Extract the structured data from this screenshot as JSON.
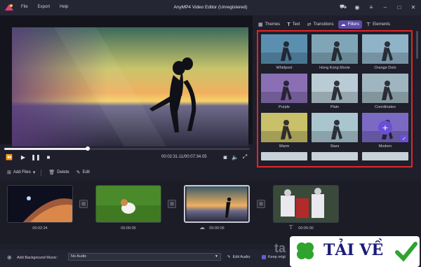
{
  "app": {
    "title": "AnyMP4 Video Editor (Unregistered)",
    "menu": [
      "File",
      "Export",
      "Help"
    ]
  },
  "player": {
    "time": "00:02:31.11/00:07:34.05",
    "progress_fraction": 0.34
  },
  "toolbar": {
    "add_files": "Add Files",
    "delete": "Delete",
    "edit": "Edit"
  },
  "tabs": [
    {
      "label": "Themes",
      "icon": "themes-icon"
    },
    {
      "label": "Text",
      "icon": "text-icon"
    },
    {
      "label": "Transitions",
      "icon": "transitions-icon"
    },
    {
      "label": "Filters",
      "icon": "filters-icon",
      "active": true
    },
    {
      "label": "Elements",
      "icon": "elements-icon"
    }
  ],
  "filters": [
    {
      "label": "Whirlpool",
      "tint": "#5b8fb0"
    },
    {
      "label": "Hong Kong Movie",
      "tint": "#7fa6b7"
    },
    {
      "label": "Orange Dots",
      "tint": "#8fb3c7"
    },
    {
      "label": "Purple",
      "tint": "#8a6fb5"
    },
    {
      "label": "Plain",
      "tint": "#b9cbd4"
    },
    {
      "label": "Coordinates",
      "tint": "#9fb6c0"
    },
    {
      "label": "Warm",
      "tint": "#c9c06a"
    },
    {
      "label": "Stars",
      "tint": "#a9c6cf"
    },
    {
      "label": "Modern",
      "tint": "#7a6ac4",
      "selected": true
    }
  ],
  "timeline": {
    "clips": [
      {
        "duration": "00:02:24"
      },
      {
        "duration": "00:00:05"
      },
      {
        "duration": "00:00:05",
        "selected": true
      },
      {
        "duration": "00:05:00"
      }
    ]
  },
  "bottom": {
    "bg_music_label": "Add Background Music:",
    "bg_music_value": "No Audio",
    "edit_audio": "Edit Audio",
    "keep_original": "Keep origi"
  },
  "watermark": {
    "text": "TẢI VỀ",
    "faint": "ta"
  },
  "colors": {
    "accent": "#5c4ba6",
    "highlight_border": "#e0262a"
  }
}
